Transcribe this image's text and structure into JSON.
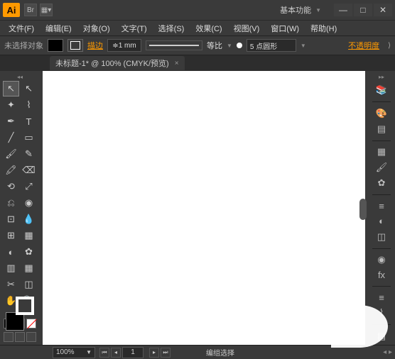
{
  "app": {
    "logo": "Ai"
  },
  "workspace": "基本功能",
  "menu": {
    "file": "文件(F)",
    "edit": "编辑(E)",
    "object": "对象(O)",
    "type": "文字(T)",
    "select": "选择(S)",
    "effect": "效果(C)",
    "view": "视图(V)",
    "window": "窗口(W)",
    "help": "帮助(H)"
  },
  "controlbar": {
    "no_selection": "未选择对象",
    "stroke_label": "描边",
    "stroke_value": "1 mm",
    "uniform": "等比",
    "profile": "5 点圆形",
    "opacity": "不透明度"
  },
  "tab": {
    "title": "未标题-1* @ 100% (CMYK/预览)",
    "close": "×"
  },
  "status": {
    "zoom": "100%",
    "page": "1",
    "mode": "编组选择"
  },
  "tools": {
    "selection": "↖",
    "direct": "↖",
    "wand": "✦",
    "lasso": "⌇",
    "pen": "✒",
    "type": "T",
    "line": "╱",
    "rect": "▭",
    "brush": "🖌",
    "pencil": "✎",
    "blob": "🖍",
    "eraser": "⌫",
    "rotate": "⟲",
    "scale": "⤢",
    "width": "⎌",
    "shape": "◉",
    "free": "⊡",
    "eyedrop": "💧",
    "mesh": "⊞",
    "gradient": "▦",
    "blend": "◐",
    "symbol": "✿",
    "graph": "▥",
    "artboard": "▦",
    "slice": "✂",
    "perspective": "◫",
    "hand": "✋",
    "zoom": "🔍"
  },
  "rightpanel": {
    "library": "📚",
    "color": "🎨",
    "guide": "▤",
    "swatch": "▦",
    "brushes": "🖌",
    "symbols": "✿",
    "stroke": "≡",
    "grad": "◐",
    "trans": "◫",
    "appear": "◉",
    "graphic": "fx",
    "align": "≡",
    "path": "⌇",
    "layers": "▤"
  }
}
